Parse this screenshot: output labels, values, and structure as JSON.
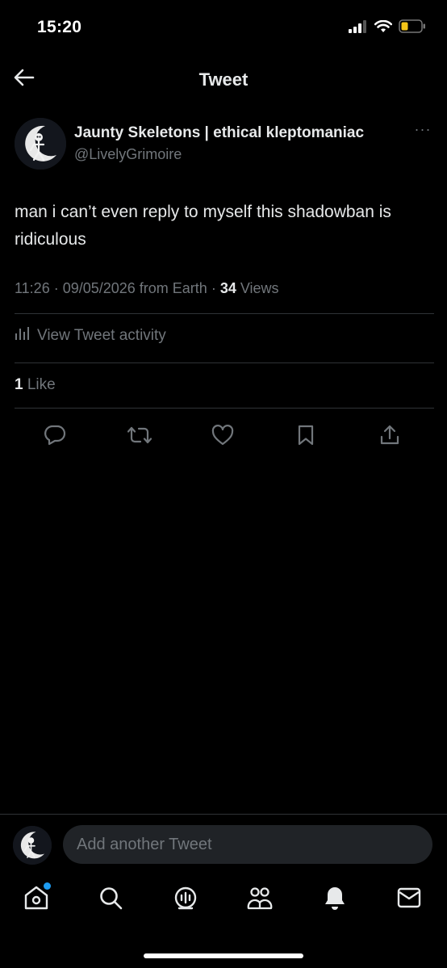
{
  "status_bar": {
    "time": "15:20",
    "icons": [
      "cellular-signal-icon",
      "wifi-icon",
      "battery-low-icon"
    ]
  },
  "header": {
    "title": "Tweet",
    "back_icon": "arrow-left-icon"
  },
  "tweet": {
    "author": {
      "display_name": "Jaunty Skeletons | ethical kleptomaniac",
      "handle": "@LivelyGrimoire",
      "avatar_icon": "skeleton-moon-avatar"
    },
    "more_label": "···",
    "text": "man i can’t even reply to myself this shadowban is ridiculous",
    "meta": {
      "timestamp": "11:26 · 09/05/2026 from Earth · ",
      "views_count": "34",
      "views_label": " Views"
    },
    "activity_label": "View Tweet activity",
    "likes": {
      "count": "1",
      "label": " Like"
    },
    "actions": [
      "reply-icon",
      "retweet-icon",
      "like-icon",
      "bookmark-icon",
      "share-icon"
    ]
  },
  "reply_bar": {
    "placeholder": "Add another Tweet"
  },
  "tab_bar": {
    "tabs": [
      "home-icon",
      "search-icon",
      "spaces-icon",
      "communities-icon",
      "notifications-icon",
      "messages-icon"
    ]
  },
  "colors": {
    "background": "#000000",
    "primary_text": "#e7e9ea",
    "secondary_text": "#71767b",
    "divider": "#2f3336",
    "accent": "#1d9bf0",
    "battery": "#f5c518"
  }
}
